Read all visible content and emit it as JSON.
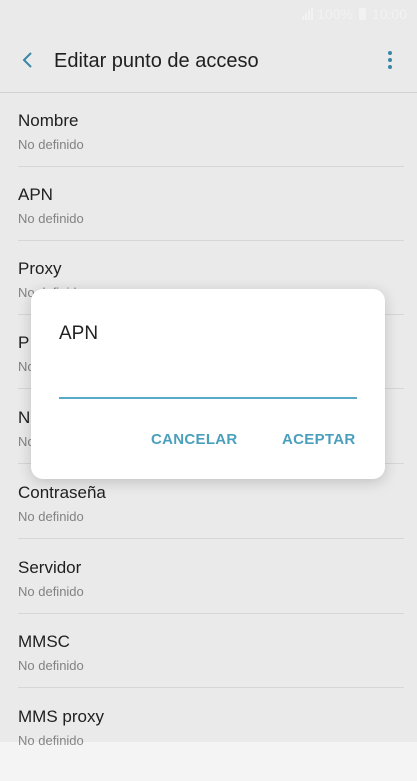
{
  "status_bar": {
    "battery_level": "100%",
    "time": "10:00",
    "colors": {
      "text": "#ffffff"
    }
  },
  "app_bar": {
    "title": "Editar punto de acceso",
    "back_icon": "chevron-left-icon",
    "more_icon": "more-vertical-icon"
  },
  "settings_items": [
    {
      "title": "Nombre",
      "value": "No definido"
    },
    {
      "title": "APN",
      "value": "No definido"
    },
    {
      "title": "Proxy",
      "value": "No definido"
    },
    {
      "title": "P",
      "value": "No definido"
    },
    {
      "title": "N",
      "value": "No definido"
    },
    {
      "title": "Contraseña",
      "value": "No definido"
    },
    {
      "title": "Servidor",
      "value": "No definido"
    },
    {
      "title": "MMSC",
      "value": "No definido"
    },
    {
      "title": "MMS proxy",
      "value": "No definido"
    }
  ],
  "dialog": {
    "title": "APN",
    "input_value": "",
    "cancel_label": "CANCELAR",
    "ok_label": "ACEPTAR"
  },
  "colors": {
    "accent": "#4aa0bc",
    "background": "#f7f7f7",
    "dialog_bg": "#ffffff"
  }
}
